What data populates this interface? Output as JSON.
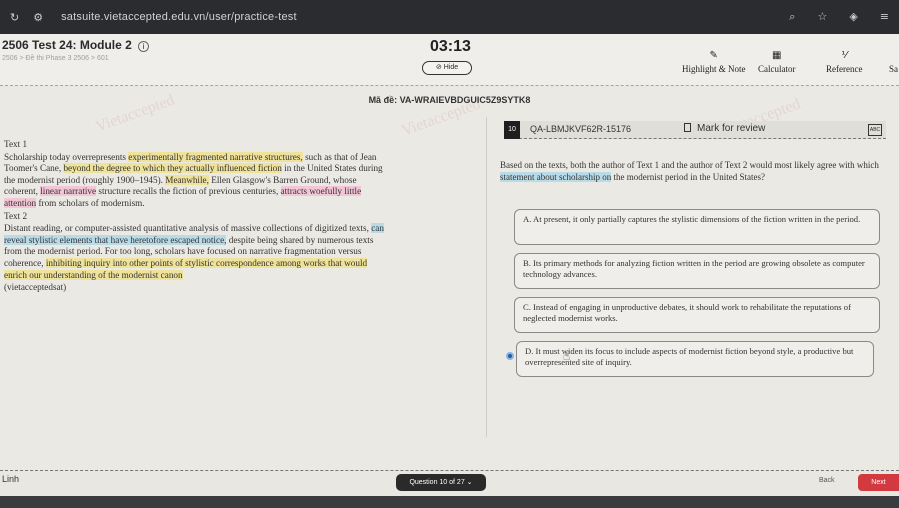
{
  "browser": {
    "url": "satsuite.vietaccepted.edu.vn/user/practice-test"
  },
  "header": {
    "test_title": "2506 Test 24: Module 2",
    "breadcrumb": "2506 > Đề thi Phase 3 2506 > 601",
    "timer": "03:13",
    "hide_label": "Hide",
    "tools": {
      "highlight": "Highlight & Note",
      "calculator": "Calculator",
      "reference": "Reference",
      "more": "Sa"
    }
  },
  "exam_code": "Mã đề: VA-WRAIEVBDGUIC5Z9SYTK8",
  "watermarks": [
    "Vietaccepted",
    "Vietaccepted",
    "Vietaccepted"
  ],
  "passage": {
    "text1_label": "Text 1",
    "text1": [
      {
        "t": "Scholarship today overrepresents ",
        "hl": ""
      },
      {
        "t": "experimentally fragmented narrative structures,",
        "hl": "yellow"
      },
      {
        "t": " such as that of Jean Toomer's Cane, ",
        "hl": ""
      },
      {
        "t": "beyond the degree to which they actually influenced fiction",
        "hl": "yellow"
      },
      {
        "t": " in the United States during the modernist period (roughly 1900–1945). ",
        "hl": ""
      },
      {
        "t": "Meanwhile,",
        "hl": "yellow"
      },
      {
        "t": " Ellen Glasgow's Barren Ground, whose coherent, ",
        "hl": ""
      },
      {
        "t": "linear narrative",
        "hl": "pink"
      },
      {
        "t": " structure recalls the fiction of previous centuries, ",
        "hl": ""
      },
      {
        "t": "attracts woefully little attention",
        "hl": "pink"
      },
      {
        "t": " from scholars of modernism.",
        "hl": ""
      }
    ],
    "text2_label": "Text 2",
    "text2": [
      {
        "t": "Distant reading, or computer-assisted quantitative analysis of massive collections of digitized texts, ",
        "hl": ""
      },
      {
        "t": "can reveal stylistic elements that have heretofore escaped notice,",
        "hl": "blue"
      },
      {
        "t": " despite being shared by numerous texts from the modernist period. For too long, scholars have focused on narrative fragmentation versus coherence, ",
        "hl": ""
      },
      {
        "t": "inhibiting inquiry into other points of stylistic correspondence among works that would enrich our understanding of the modernist canon",
        "hl": "yellow"
      }
    ],
    "source": "(vietacceptedsat)"
  },
  "question": {
    "number": "10",
    "id": "QA-LBMJKVF62R-15176",
    "mark_review": "Mark for review",
    "abc": "ABC",
    "stem_before": "Based on the texts, both the author of Text 1 and the author of Text 2 would most likely agree with which ",
    "stem_highlight": "statement about scholarship on",
    "stem_after": " the modernist period in the United States?",
    "choices": [
      {
        "letter": "A.",
        "text": "At present, it only partially captures the stylistic dimensions of the fiction written in the period."
      },
      {
        "letter": "B.",
        "text": "Its primary methods for analyzing fiction written in the period are growing obsolete as computer technology advances."
      },
      {
        "letter": "C.",
        "text": "Instead of engaging in unproductive debates, it should work to rehabilitate the reputations of neglected modernist works."
      },
      {
        "letter": "D.",
        "text": "It must widen its focus to include aspects of modernist fiction beyond style, a productive but overrepresented site of inquiry."
      }
    ]
  },
  "footer": {
    "student": "Linh",
    "question_nav": "Question 10 of 27",
    "back": "Back",
    "next": "Next"
  }
}
